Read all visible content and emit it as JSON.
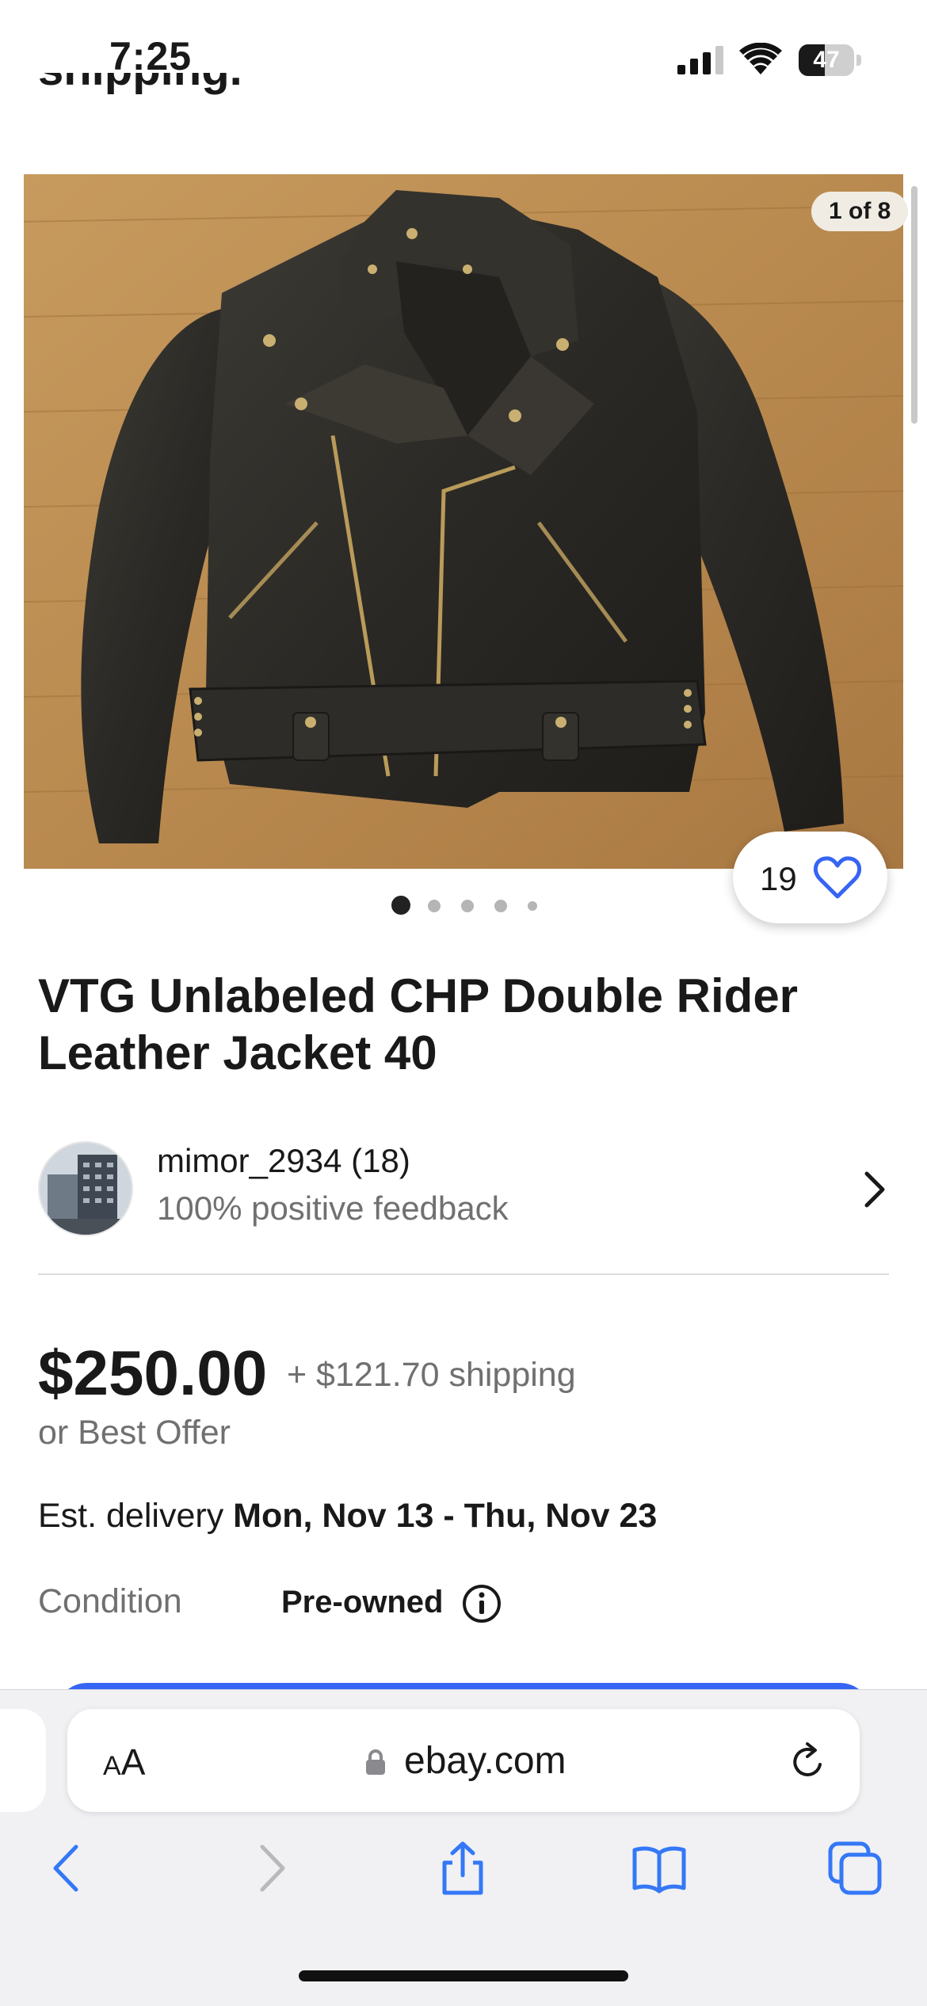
{
  "status_bar": {
    "time": "7:25",
    "battery": "47",
    "battery_level": 0.47
  },
  "header": {
    "partial_text": "shipping."
  },
  "gallery": {
    "counter": "1 of 8",
    "watchers": "19",
    "dot_count": 5,
    "active_dot": 0
  },
  "listing": {
    "title": "VTG Unlabeled CHP Double Rider Leather Jacket 40"
  },
  "seller": {
    "name": "mimor_2934 (18)",
    "feedback": "100% positive feedback"
  },
  "pricing": {
    "price": "$250.00",
    "shipping": "+ $121.70 shipping",
    "offer": "or Best Offer",
    "delivery_prefix": "Est. delivery ",
    "delivery_dates": "Mon, Nov 13 - Thu, Nov 23",
    "condition_label": "Condition",
    "condition_value": "Pre-owned"
  },
  "browser": {
    "text_size_label_big": "A",
    "text_size_label_small": "A",
    "url": "ebay.com"
  },
  "colors": {
    "accent": "#3665f3",
    "text": "#191919",
    "muted": "#707070",
    "safari_blue": "#3478f6"
  },
  "icons": [
    "signal-icon",
    "wifi-icon",
    "battery-icon",
    "heart-icon",
    "chevron-right-icon",
    "info-icon",
    "lock-icon",
    "reload-icon",
    "back-icon",
    "forward-icon",
    "share-icon",
    "bookmarks-icon",
    "tabs-icon"
  ]
}
